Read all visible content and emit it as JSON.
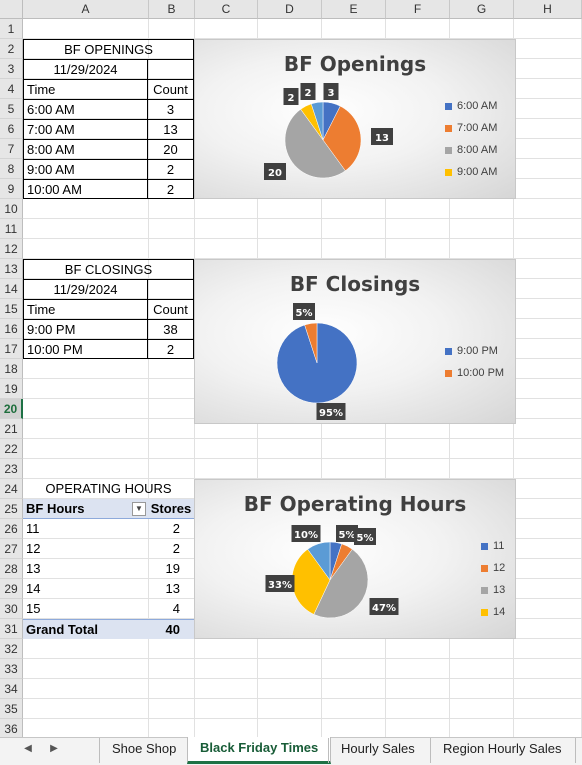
{
  "columns": [
    "A",
    "B",
    "C",
    "D",
    "E",
    "F",
    "G",
    "H"
  ],
  "rows": [
    "1",
    "2",
    "3",
    "4",
    "5",
    "6",
    "7",
    "8",
    "9",
    "10",
    "11",
    "12",
    "13",
    "14",
    "15",
    "16",
    "17",
    "18",
    "19",
    "20",
    "21",
    "22",
    "23",
    "24",
    "25",
    "26",
    "27",
    "28",
    "29",
    "30",
    "31",
    "32",
    "33",
    "34",
    "35",
    "36"
  ],
  "selected_row": "20",
  "openings": {
    "title": "BF OPENINGS",
    "date": "11/29/2024",
    "col_time": "Time",
    "col_count": "Count",
    "rows": [
      {
        "time": "6:00 AM",
        "count": "3"
      },
      {
        "time": "7:00 AM",
        "count": "13"
      },
      {
        "time": "8:00 AM",
        "count": "20"
      },
      {
        "time": "9:00 AM",
        "count": "2"
      },
      {
        "time": "10:00 AM",
        "count": "2"
      }
    ]
  },
  "closings": {
    "title": "BF CLOSINGS",
    "date": "11/29/2024",
    "col_time": "Time",
    "col_count": "Count",
    "rows": [
      {
        "time": "9:00 PM",
        "count": "38"
      },
      {
        "time": "10:00 PM",
        "count": "2"
      }
    ]
  },
  "hours": {
    "title": "OPERATING HOURS",
    "col_hours": "BF Hours",
    "col_stores": "Stores",
    "rows": [
      {
        "hours": "11",
        "stores": "2"
      },
      {
        "hours": "12",
        "stores": "2"
      },
      {
        "hours": "13",
        "stores": "19"
      },
      {
        "hours": "14",
        "stores": "13"
      },
      {
        "hours": "15",
        "stores": "4"
      }
    ],
    "total_label": "Grand Total",
    "total_value": "40"
  },
  "chart_data": [
    {
      "type": "pie",
      "title": "BF Openings",
      "categories": [
        "6:00 AM",
        "7:00 AM",
        "8:00 AM",
        "9:00 AM",
        "10:00 AM"
      ],
      "values": [
        3,
        13,
        20,
        2,
        2
      ],
      "labels": [
        "3",
        "13",
        "20",
        "2",
        "2"
      ],
      "colors": [
        "#4472c4",
        "#ed7d31",
        "#a5a5a5",
        "#ffc000",
        "#5b9bd5"
      ],
      "legend": [
        "6:00 AM",
        "7:00 AM",
        "8:00 AM",
        "9:00 AM"
      ],
      "legend_position": "right"
    },
    {
      "type": "pie",
      "title": "BF Closings",
      "categories": [
        "9:00 PM",
        "10:00 PM"
      ],
      "values": [
        95,
        5
      ],
      "labels": [
        "95%",
        "5%"
      ],
      "colors": [
        "#4472c4",
        "#ed7d31"
      ],
      "legend": [
        "9:00 PM",
        "10:00 PM"
      ],
      "legend_position": "right"
    },
    {
      "type": "pie",
      "title": "BF Operating Hours",
      "categories": [
        "11",
        "12",
        "13",
        "14",
        "15"
      ],
      "values": [
        5,
        5,
        47,
        33,
        10
      ],
      "labels": [
        "5%",
        "5%",
        "47%",
        "33%",
        "10%"
      ],
      "colors": [
        "#4472c4",
        "#ed7d31",
        "#a5a5a5",
        "#ffc000",
        "#5b9bd5"
      ],
      "legend": [
        "11",
        "12",
        "13",
        "14"
      ],
      "legend_position": "right"
    }
  ],
  "tabs": {
    "prev": "◀",
    "next": "▶",
    "items": [
      "Shoe Shop",
      "Black Friday Times",
      "Hourly Sales",
      "Region Hourly Sales"
    ],
    "active": "Black Friday Times"
  }
}
